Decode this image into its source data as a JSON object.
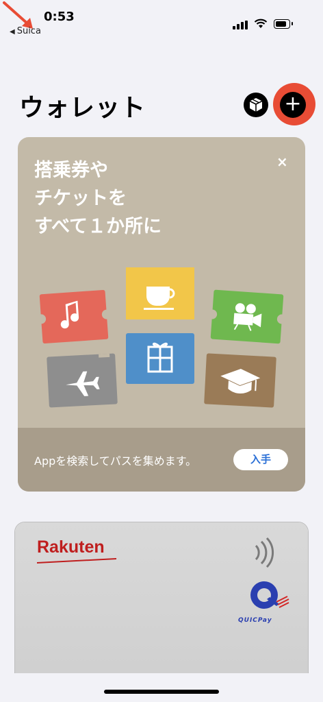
{
  "status_bar": {
    "time": "0:53",
    "back_app": "Suica"
  },
  "header": {
    "title": "ウォレット"
  },
  "promo": {
    "lines": [
      "搭乗券や",
      "チケットを",
      "すべて１か所に"
    ],
    "close_glyph": "×",
    "footer_text": "Appを検索してパスを集めます。",
    "get_label": "入手",
    "ticket_colors": {
      "music": "#e4685a",
      "coffee": "#f2c649",
      "movie": "#6fb84f",
      "flight": "#8e8e8e",
      "gift": "#4f8fc9",
      "education": "#9a7b57"
    }
  },
  "card": {
    "brand": "Rakuten",
    "payment": "QUICPay",
    "contactless_icon": "contactless-icon"
  },
  "accent": {
    "highlight": "#e84c35",
    "link": "#2a6fd6"
  }
}
